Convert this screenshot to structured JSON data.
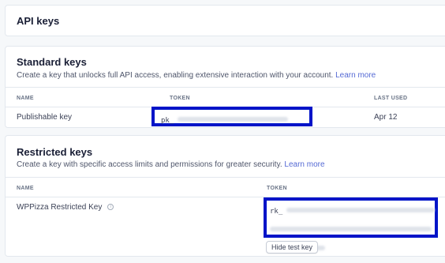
{
  "page": {
    "title": "API keys"
  },
  "standard": {
    "title": "Standard keys",
    "description": "Create a key that unlocks full API access, enabling extensive interaction with your account.",
    "learn_more": "Learn more",
    "columns": {
      "name": "NAME",
      "token": "TOKEN",
      "last_used": "LAST USED"
    },
    "rows": [
      {
        "name": "Publishable key",
        "token_prefix": "pk_",
        "last_used": "Apr 12"
      }
    ]
  },
  "restricted": {
    "title": "Restricted keys",
    "description": "Create a key with specific access limits and permissions for greater security.",
    "learn_more": "Learn more",
    "columns": {
      "name": "NAME",
      "token": "TOKEN"
    },
    "rows": [
      {
        "name": "WPPizza Restricted Key",
        "token_prefix": "rk_",
        "hide_button": "Hide test key"
      }
    ]
  },
  "colors": {
    "highlight": "#0014c8",
    "link": "#5469d4"
  },
  "icons": {
    "info": "info-icon"
  }
}
